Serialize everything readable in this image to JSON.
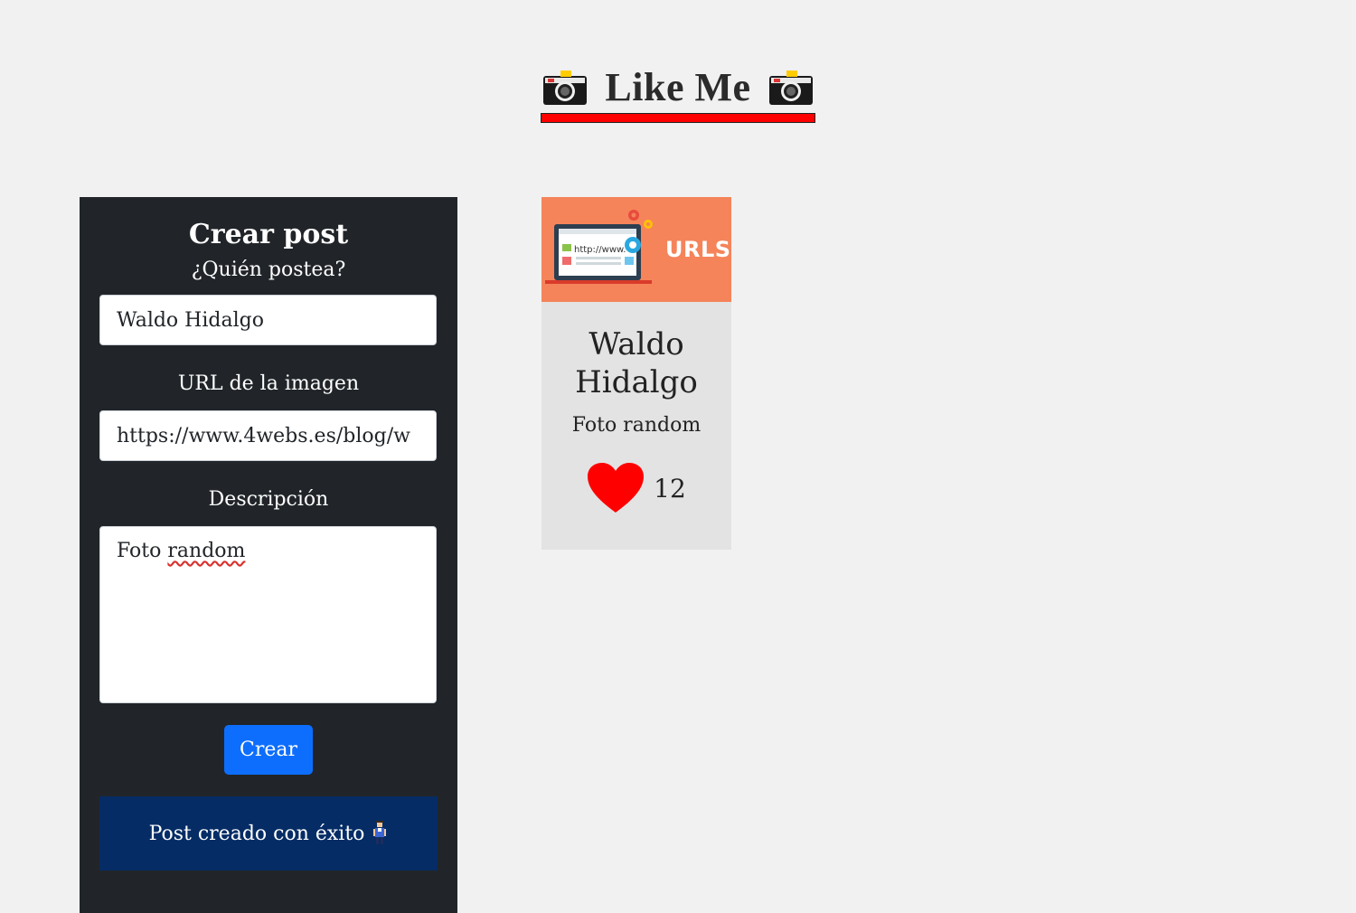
{
  "header": {
    "title": "Like Me",
    "underline_color": "#ff0000",
    "left_icon": "camera-icon",
    "right_icon": "camera-icon"
  },
  "form": {
    "title": "Crear post",
    "author_label": "¿Quién postea?",
    "author_value": "Waldo Hidalgo",
    "url_label": "URL de la imagen",
    "url_value": "https://www.4webs.es/blog/w",
    "description_label": "Descripción",
    "description_value": "Foto random",
    "description_value_part1": "Foto ",
    "description_value_part2": "random",
    "submit_label": "Crear",
    "success_message": "Post creado con éxito",
    "success_icon": "person-icon",
    "colors": {
      "panel": "#212529",
      "button": "#0d6efd",
      "alert": "#052c65"
    }
  },
  "posts": [
    {
      "image_text": "URLS",
      "image_url_text": "http://www.",
      "author": "Waldo Hidalgo",
      "description": "Foto random",
      "likes": "12",
      "like_icon": "heart-icon",
      "colors": {
        "image_bg": "#f5845a",
        "heart": "#ff0000"
      }
    }
  ]
}
